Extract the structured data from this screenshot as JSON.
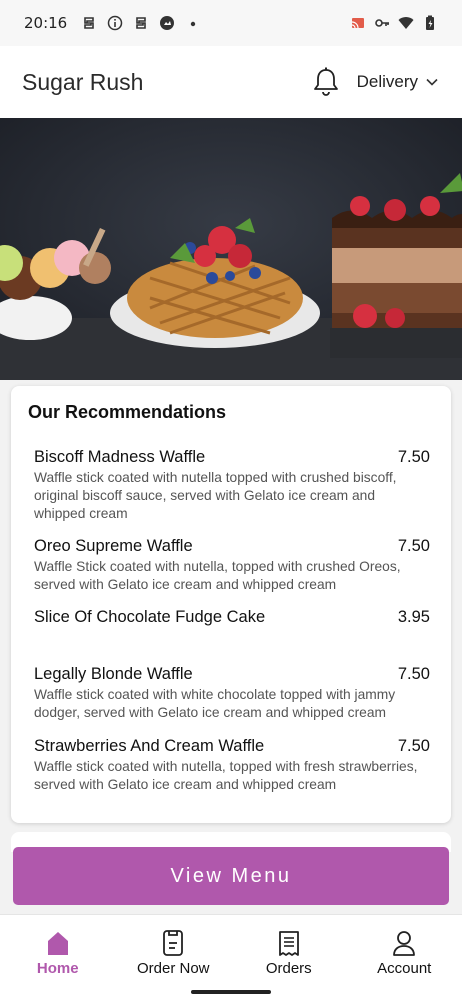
{
  "status_bar": {
    "time": "20:16",
    "icons_left": [
      "s-icon",
      "info-icon",
      "s-icon",
      "gallery-icon",
      "dot-icon"
    ],
    "icons_right": [
      "cast-icon",
      "key-icon",
      "wifi-icon",
      "battery-icon"
    ]
  },
  "header": {
    "title": "Sugar Rush",
    "notification_icon": "bell-icon",
    "mode_label": "Delivery",
    "mode_icon": "chevron-down-icon"
  },
  "hero": {
    "image_desc": ""
  },
  "recommendations": {
    "title": "Our Recommendations",
    "items": [
      {
        "name": "Biscoff Madness Waffle",
        "price": "7.50",
        "description": "Waffle stick coated with nutella topped with crushed biscoff, original biscoff sauce, served with Gelato ice cream and whipped cream"
      },
      {
        "name": "Oreo Supreme Waffle",
        "price": "7.50",
        "description": "Waffle Stick coated with nutella, topped with crushed Oreos, served with Gelato ice cream and whipped cream"
      },
      {
        "name": "Slice Of Chocolate Fudge Cake",
        "price": "3.95",
        "description": ""
      },
      {
        "name": "Legally Blonde Waffle",
        "price": "7.50",
        "description": "Waffle stick coated with white chocolate topped with jammy dodger, served with Gelato ice cream and whipped cream"
      },
      {
        "name": "Strawberries And Cream Waffle",
        "price": "7.50",
        "description": "Waffle stick coated with nutella, topped with fresh strawberries, served with Gelato ice cream and whipped cream"
      }
    ]
  },
  "view_menu_label": "View Menu",
  "nav": {
    "items": [
      {
        "label": "Home",
        "icon": "home-icon",
        "active": true
      },
      {
        "label": "Order Now",
        "icon": "order-icon",
        "active": false
      },
      {
        "label": "Orders",
        "icon": "receipt-icon",
        "active": false
      },
      {
        "label": "Account",
        "icon": "user-icon",
        "active": false
      }
    ]
  },
  "colors": {
    "accent": "#b058ac",
    "background": "#f2f2f2"
  }
}
